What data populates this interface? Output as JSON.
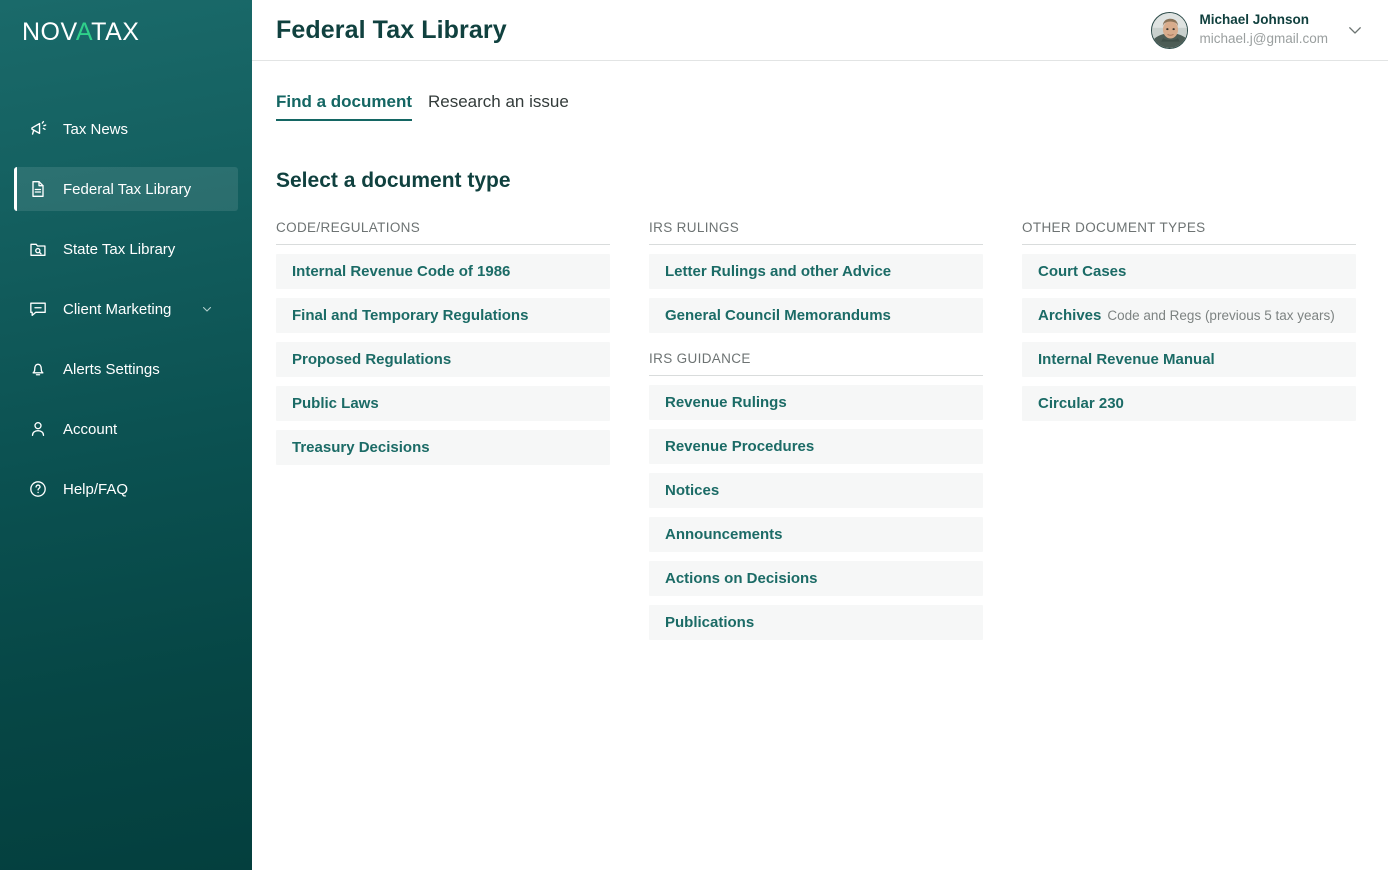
{
  "brand": {
    "name_part1": "NOV",
    "name_accent": "A",
    "name_part2": "TAX",
    "accent_color": "#2fd08a"
  },
  "sidebar": {
    "items": [
      {
        "label": "Tax News",
        "icon": "megaphone-icon",
        "active": false,
        "chevron": false
      },
      {
        "label": "Federal Tax Library",
        "icon": "document-icon",
        "active": true,
        "chevron": false
      },
      {
        "label": "State Tax Library",
        "icon": "folder-search-icon",
        "active": false,
        "chevron": false
      },
      {
        "label": "Client Marketing",
        "icon": "message-icon",
        "active": false,
        "chevron": true
      },
      {
        "label": "Alerts Settings",
        "icon": "bell-icon",
        "active": false,
        "chevron": false
      },
      {
        "label": "Account",
        "icon": "person-icon",
        "active": false,
        "chevron": false
      },
      {
        "label": "Help/FAQ",
        "icon": "help-circle-icon",
        "active": false,
        "chevron": false
      }
    ]
  },
  "header": {
    "title": "Federal Tax Library",
    "user": {
      "name": "Michael Johnson",
      "email": "michael.j@gmail.com",
      "avatar": "user-photo",
      "chevron": "chevron-down-icon"
    }
  },
  "tabs": [
    {
      "label": "Find a document",
      "active": true
    },
    {
      "label": "Research an issue",
      "active": false
    }
  ],
  "main": {
    "section_title": "Select a document type",
    "columns": [
      {
        "groups": [
          {
            "label": "CODE/REGULATIONS",
            "items": [
              {
                "label": "Internal Revenue Code of 1986",
                "sub": ""
              },
              {
                "label": "Final and Temporary Regulations",
                "sub": ""
              },
              {
                "label": "Proposed Regulations",
                "sub": ""
              },
              {
                "label": "Public Laws",
                "sub": ""
              },
              {
                "label": "Treasury Decisions",
                "sub": ""
              }
            ]
          }
        ]
      },
      {
        "groups": [
          {
            "label": "IRS RULINGS",
            "items": [
              {
                "label": "Letter Rulings and other Advice",
                "sub": ""
              },
              {
                "label": "General Council Memorandums",
                "sub": ""
              }
            ]
          },
          {
            "label": "IRS GUIDANCE",
            "items": [
              {
                "label": "Revenue Rulings",
                "sub": ""
              },
              {
                "label": "Revenue Procedures",
                "sub": ""
              },
              {
                "label": "Notices",
                "sub": ""
              },
              {
                "label": "Announcements",
                "sub": ""
              },
              {
                "label": "Actions on Decisions",
                "sub": ""
              },
              {
                "label": "Publications",
                "sub": ""
              }
            ]
          }
        ]
      },
      {
        "groups": [
          {
            "label": "OTHER DOCUMENT TYPES",
            "items": [
              {
                "label": "Court Cases",
                "sub": ""
              },
              {
                "label": "Archives",
                "sub": "Code and Regs (previous 5 tax years)"
              },
              {
                "label": "Internal Revenue Manual",
                "sub": ""
              },
              {
                "label": "Circular 230",
                "sub": ""
              }
            ]
          }
        ]
      }
    ]
  }
}
